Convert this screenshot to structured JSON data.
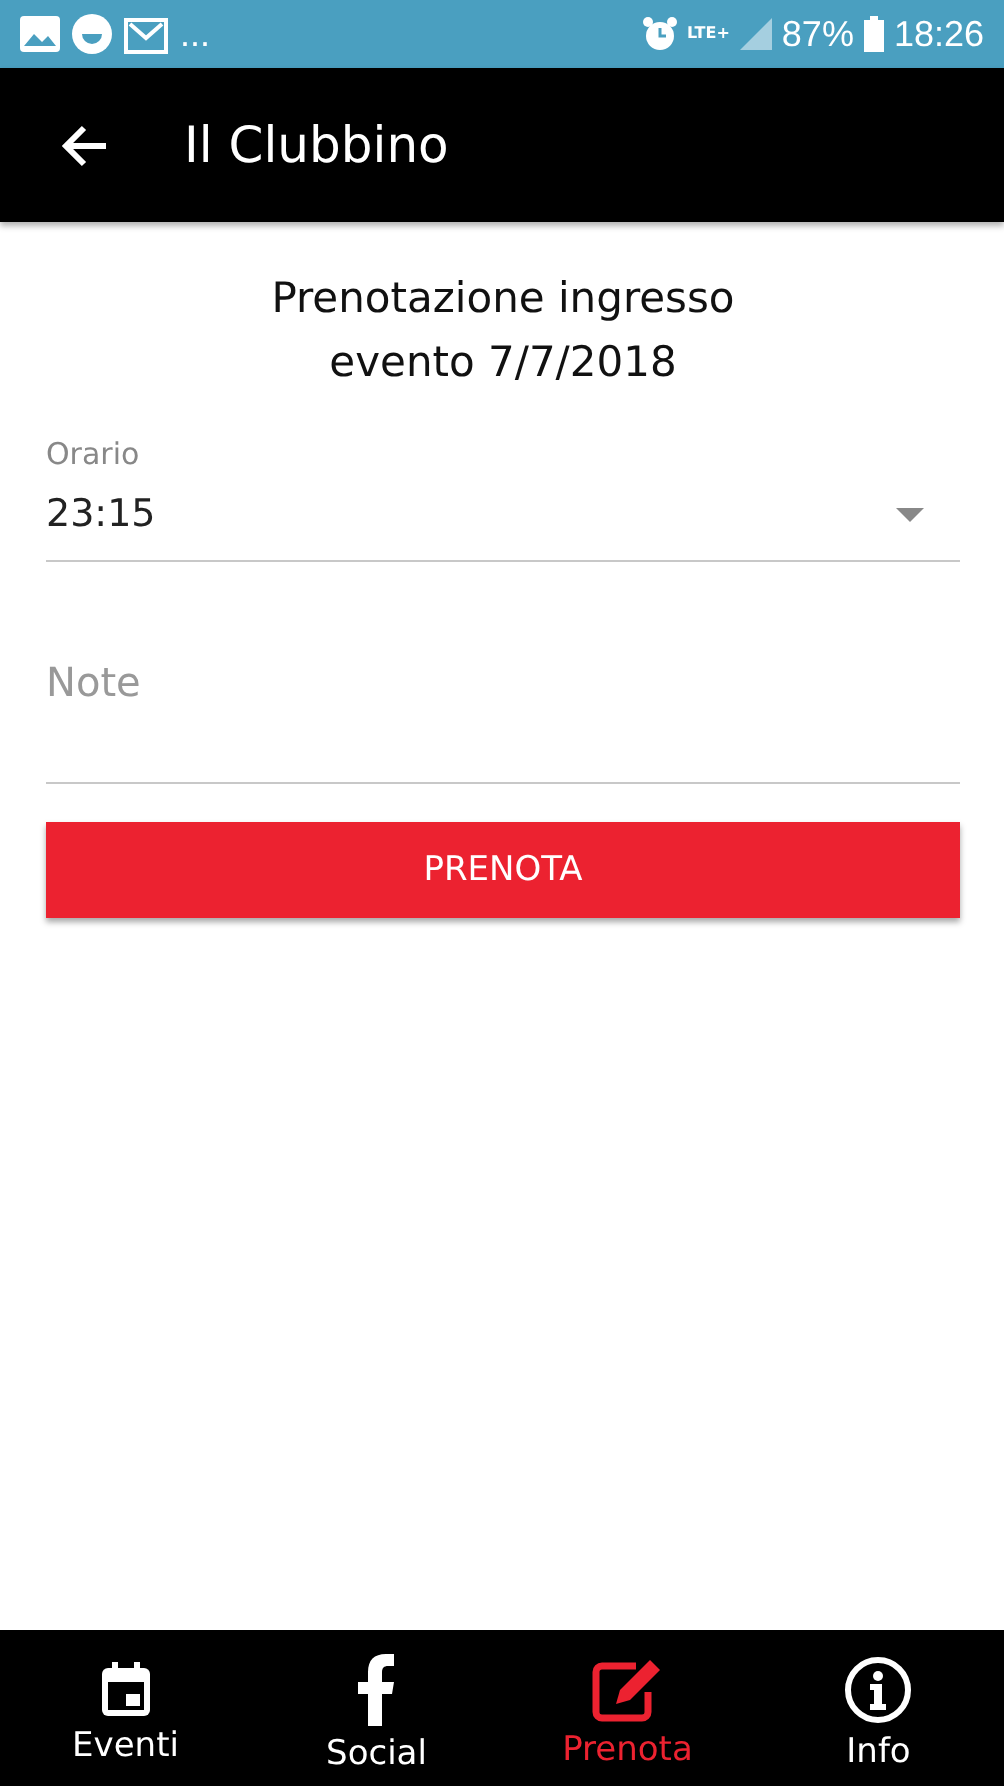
{
  "status_bar": {
    "overflow": "...",
    "network": "LTE+",
    "battery": "87%",
    "time": "18:26"
  },
  "app_bar": {
    "title": "Il Clubbino"
  },
  "heading": [
    "Prenotazione ingresso",
    "evento 7/7/2018"
  ],
  "time_field": {
    "label": "Orario",
    "value": "23:15"
  },
  "note_field": {
    "placeholder": "Note"
  },
  "submit_button": "PRENOTA",
  "tabs": [
    {
      "kind": "calendar",
      "label": "Eventi",
      "selected": false
    },
    {
      "kind": "facebook",
      "label": "Social",
      "selected": false
    },
    {
      "kind": "edit",
      "label": "Prenota",
      "selected": true
    },
    {
      "kind": "info",
      "label": "Info",
      "selected": false
    }
  ]
}
